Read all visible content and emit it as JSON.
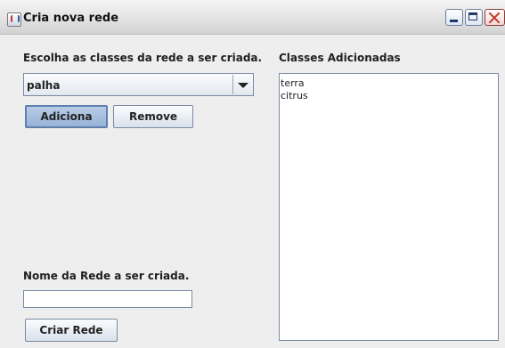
{
  "window": {
    "title": "Cria nova rede",
    "controls": {
      "minimize": "minimize",
      "maximize": "maximize",
      "close": "close"
    }
  },
  "left_panel": {
    "choose_label": "Escolha as classes da rede a ser criada.",
    "class_select": {
      "selected": "palha"
    },
    "add_button": "Adiciona",
    "remove_button": "Remove",
    "network_name_label": "Nome da Rede a ser criada.",
    "network_name_value": "",
    "create_button": "Criar Rede"
  },
  "right_panel": {
    "list_label": "Classes Adicionadas",
    "items": [
      "terra",
      "citrus"
    ]
  },
  "colors": {
    "window_bg": "#eeeeee",
    "button_pressed": "#98b3d8",
    "border": "#7a8aa3",
    "close_red": "#c0392b"
  }
}
